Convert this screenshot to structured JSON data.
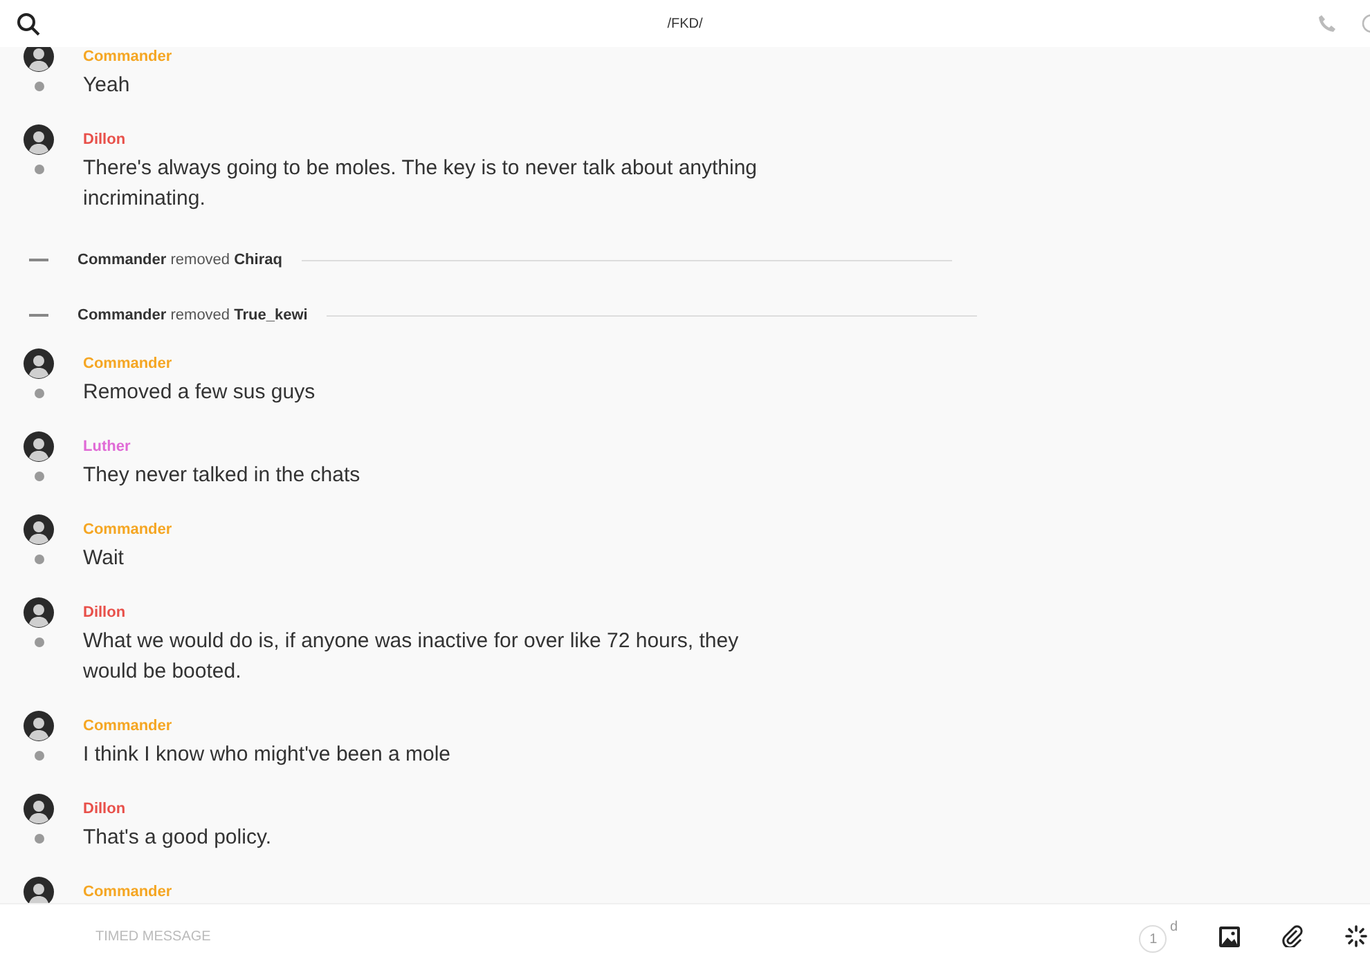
{
  "header": {
    "title": "/FKD/"
  },
  "messages": [
    {
      "kind": "message",
      "author": "Commander",
      "color": "#f5a623",
      "text": "Yeah"
    },
    {
      "kind": "message",
      "author": "Dillon",
      "color": "#e8504a",
      "text": "There's always going to be moles. The key is to never talk about anything incriminating."
    },
    {
      "kind": "event",
      "actor": "Commander",
      "action": "removed",
      "target": "Chiraq"
    },
    {
      "kind": "event",
      "actor": "Commander",
      "action": "removed",
      "target": "True_kewi"
    },
    {
      "kind": "message",
      "author": "Commander",
      "color": "#f5a623",
      "text": "Removed a few sus guys"
    },
    {
      "kind": "message",
      "author": "Luther",
      "color": "#e06ad6",
      "text": "They never talked in the chats"
    },
    {
      "kind": "message",
      "author": "Commander",
      "color": "#f5a623",
      "text": "Wait"
    },
    {
      "kind": "message",
      "author": "Dillon",
      "color": "#e8504a",
      "text": "What we would do is, if anyone was inactive for over like 72 hours, they would be booted."
    },
    {
      "kind": "message",
      "author": "Commander",
      "color": "#f5a623",
      "text": "I think I know who might've been a mole"
    },
    {
      "kind": "message",
      "author": "Dillon",
      "color": "#e8504a",
      "text": "That's a good policy."
    },
    {
      "kind": "message",
      "author": "Commander",
      "color": "#f5a623"
    }
  ],
  "composer": {
    "placeholder": "TIMED MESSAGE",
    "timer": {
      "value": "1",
      "unit": "d"
    }
  }
}
